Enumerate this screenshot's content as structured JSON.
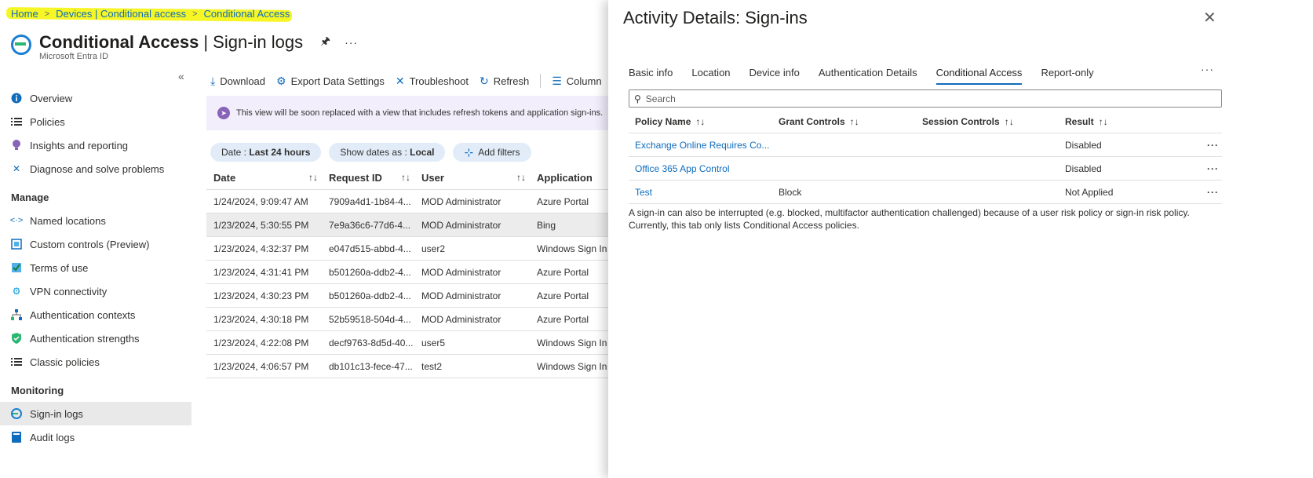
{
  "breadcrumb": {
    "items": [
      "Home",
      "Devices | Conditional access",
      "Conditional Access"
    ]
  },
  "header": {
    "title": "Conditional Access",
    "subtitle_page": "Sign-in logs",
    "service": "Microsoft Entra ID",
    "pin_icon": "pin-icon",
    "more": "···"
  },
  "sidebar": {
    "collapse": "«",
    "items": [
      {
        "label": "Overview",
        "icon": "info-icon"
      },
      {
        "label": "Policies",
        "icon": "list-icon"
      },
      {
        "label": "Insights and reporting",
        "icon": "bulb-icon"
      },
      {
        "label": "Diagnose and solve problems",
        "icon": "wrench-icon"
      }
    ],
    "manage_heading": "Manage",
    "manage_items": [
      {
        "label": "Named locations",
        "icon": "code-icon"
      },
      {
        "label": "Custom controls (Preview)",
        "icon": "square-icon"
      },
      {
        "label": "Terms of use",
        "icon": "check-icon"
      },
      {
        "label": "VPN connectivity",
        "icon": "gear-icon"
      },
      {
        "label": "Authentication contexts",
        "icon": "network-icon"
      },
      {
        "label": "Authentication strengths",
        "icon": "shield-icon"
      },
      {
        "label": "Classic policies",
        "icon": "list-icon"
      }
    ],
    "monitoring_heading": "Monitoring",
    "monitoring_items": [
      {
        "label": "Sign-in logs",
        "icon": "signin-icon"
      },
      {
        "label": "Audit logs",
        "icon": "book-icon"
      }
    ]
  },
  "toolbar": {
    "download": "Download",
    "export": "Export Data Settings",
    "troubleshoot": "Troubleshoot",
    "refresh": "Refresh",
    "columns": "Columns"
  },
  "banner": {
    "text": "This view will be soon replaced with a view that includes refresh tokens and application sign-ins."
  },
  "filters": {
    "date_label": "Date : ",
    "date_value": "Last 24 hours",
    "show_label": "Show dates as : ",
    "show_value": "Local",
    "add_filters": "Add filters"
  },
  "table": {
    "headers": [
      "Date",
      "Request ID",
      "User",
      "Application"
    ],
    "sort_glyph": "↑↓",
    "rows": [
      [
        "1/24/2024, 9:09:47 AM",
        "7909a4d1-1b84-4...",
        "MOD Administrator",
        "Azure Portal"
      ],
      [
        "1/23/2024, 5:30:55 PM",
        "7e9a36c6-77d6-4...",
        "MOD Administrator",
        "Bing"
      ],
      [
        "1/23/2024, 4:32:37 PM",
        "e047d515-abbd-4...",
        "user2",
        "Windows Sign In"
      ],
      [
        "1/23/2024, 4:31:41 PM",
        "b501260a-ddb2-4...",
        "MOD Administrator",
        "Azure Portal"
      ],
      [
        "1/23/2024, 4:30:23 PM",
        "b501260a-ddb2-4...",
        "MOD Administrator",
        "Azure Portal"
      ],
      [
        "1/23/2024, 4:30:18 PM",
        "52b59518-504d-4...",
        "MOD Administrator",
        "Azure Portal"
      ],
      [
        "1/23/2024, 4:22:08 PM",
        "decf9763-8d5d-40...",
        "user5",
        "Windows Sign In"
      ],
      [
        "1/23/2024, 4:06:57 PM",
        "db101c13-fece-47...",
        "test2",
        "Windows Sign In"
      ]
    ]
  },
  "panel": {
    "title": "Activity Details: Sign-ins",
    "close": "✕",
    "tabs": [
      "Basic info",
      "Location",
      "Device info",
      "Authentication Details",
      "Conditional Access",
      "Report-only"
    ],
    "active_tab": "Conditional Access",
    "more": "···",
    "search_placeholder": "Search",
    "headers": [
      "Policy Name",
      "Grant Controls",
      "Session Controls",
      "Result"
    ],
    "sort_glyph": "↑↓",
    "rows": [
      {
        "policy": "Exchange Online Requires Co...",
        "grant": "",
        "session": "",
        "result": "Disabled"
      },
      {
        "policy": "Office 365 App Control",
        "grant": "",
        "session": "",
        "result": "Disabled"
      },
      {
        "policy": "Test",
        "grant": "Block",
        "session": "",
        "result": "Not Applied"
      }
    ],
    "row_menu": "···",
    "note": "A sign-in can also be interrupted (e.g. blocked, multifactor authentication challenged) because of a user risk policy or sign-in risk policy. Currently, this tab only lists Conditional Access policies."
  },
  "colors": {
    "accent": "#0f6cbd",
    "highlight": "#f4f400",
    "banner_bg": "#f3eefc",
    "pill_bg": "#e1ecf8"
  }
}
